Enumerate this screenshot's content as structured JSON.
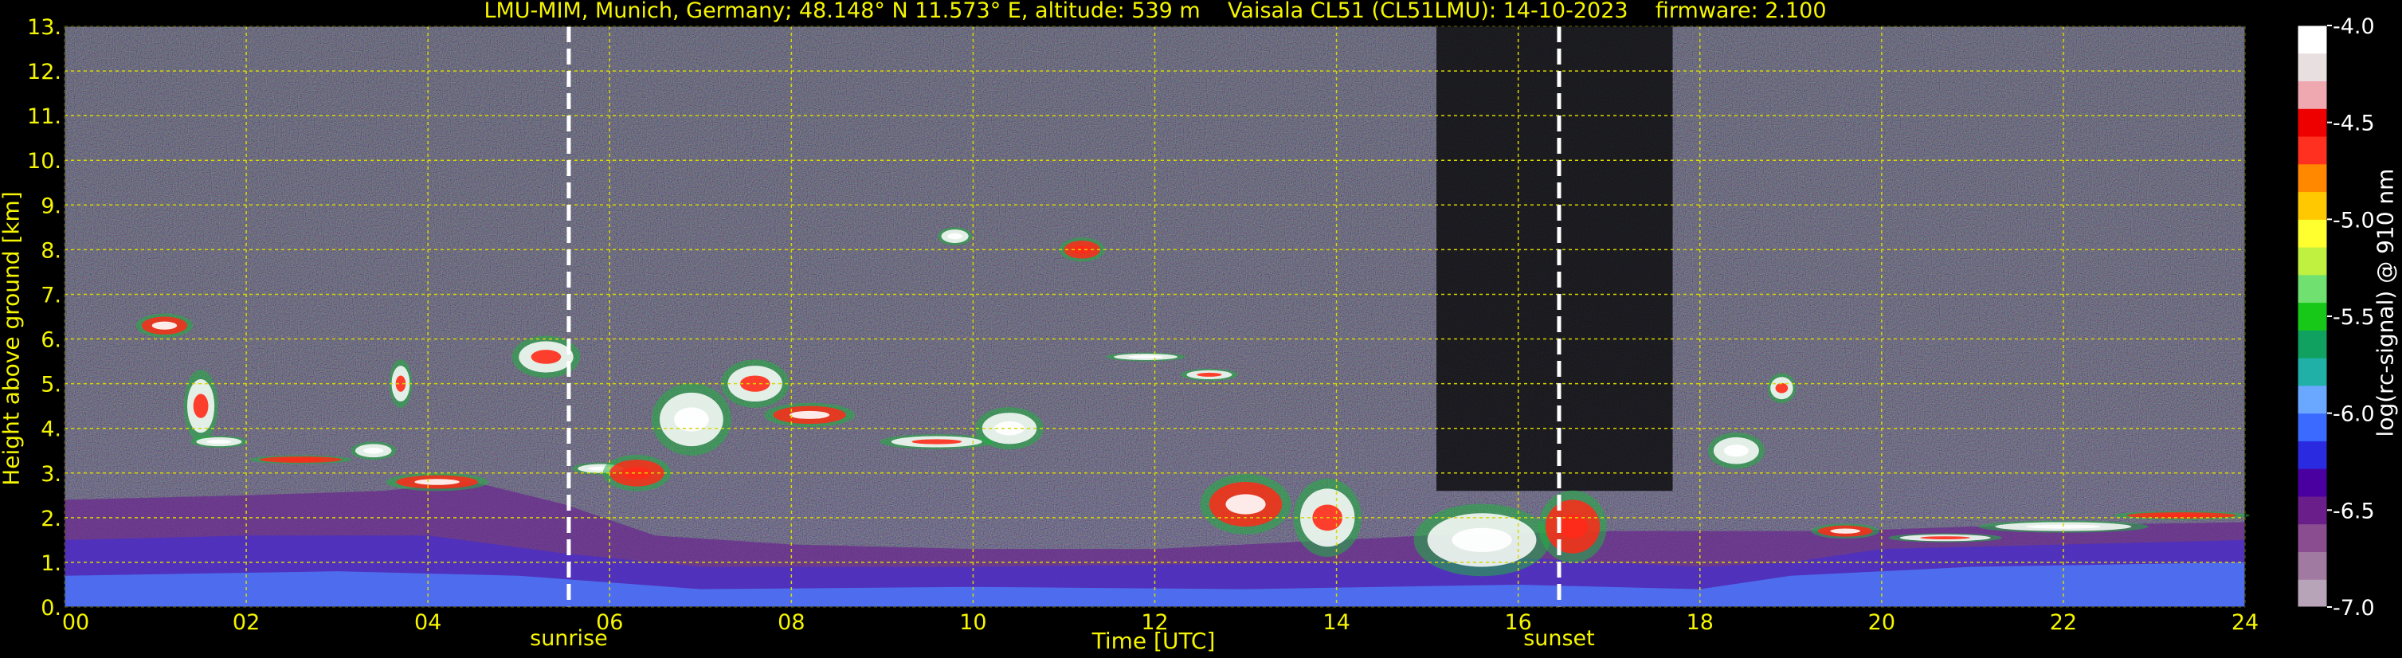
{
  "chart_data": {
    "type": "heatmap",
    "title": "LMU-MIM, Munich, Germany; 48.148° N 11.573° E, altitude: 539 m    Vaisala CL51 (CL51LMU): 14-10-2023    firmware: 2.100",
    "xlabel": "Time [UTC]",
    "ylabel": "Height above ground [km]",
    "colorbar_label": "log(rc-signal) @ 910 nm",
    "xlim": [
      0,
      24
    ],
    "ylim": [
      0,
      13
    ],
    "x_ticks": [
      "00",
      "02",
      "04",
      "06",
      "08",
      "10",
      "12",
      "14",
      "16",
      "18",
      "20",
      "22",
      "24"
    ],
    "y_ticks": [
      "0.",
      "1.",
      "2.",
      "3.",
      "4.",
      "5.",
      "6.",
      "7.",
      "8.",
      "9.",
      "10.",
      "11.",
      "12.",
      "13."
    ],
    "colorbar_range": [
      -7.0,
      -4.0
    ],
    "colorbar_ticks": [
      "-4.0",
      "-4.5",
      "-5.0",
      "-5.5",
      "-6.0",
      "-6.5",
      "-7.0"
    ],
    "grid": true,
    "markers": [
      {
        "label": "sunrise",
        "x": 5.55
      },
      {
        "label": "sunset",
        "x": 16.45
      }
    ],
    "colors": {
      "text": "#f5f500",
      "grid": "#d8d800",
      "background": "#000000",
      "marker_line": "#ffffff"
    },
    "colormap": [
      "#b8a4b8",
      "#a07aa0",
      "#8a4e90",
      "#6a1e8a",
      "#4a00a0",
      "#2a2ae0",
      "#3a6aff",
      "#6aa8ff",
      "#20b0a8",
      "#10a060",
      "#18c818",
      "#70e070",
      "#c0f040",
      "#ffff30",
      "#ffc800",
      "#ff8800",
      "#ff3020",
      "#ee0000",
      "#f0a8b0",
      "#e8e0e0",
      "#ffffff"
    ]
  }
}
